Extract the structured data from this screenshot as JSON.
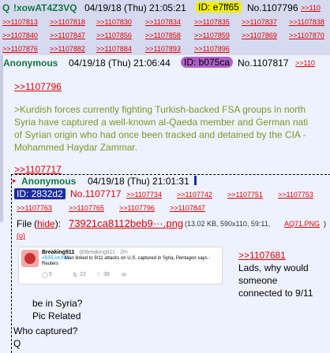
{
  "post1": {
    "name": "Q",
    "tripcode": "!xowAT4Z3VQ",
    "datetime": "04/19/18 (Thu) 21:05:21",
    "id": "ID: e7ff65",
    "number": "No.1107796",
    "trailing_link": ">>110",
    "backlinks_row1": [
      ">>1107813",
      ">>1107818",
      ">>1107830",
      ">>1107834",
      ">>1107835",
      ">>1107837",
      ">>1107838"
    ],
    "backlinks_row2": [
      ">>1107840",
      ">>1107847",
      ">>1107856",
      ">>1107858",
      ">>1107859",
      ">>1107869",
      ">>1107870"
    ],
    "backlinks_row3": [
      ">>1107876",
      ">>1107882",
      ">>1107884",
      ">>1107893",
      ">>1107896"
    ]
  },
  "post2": {
    "name": "Anonymous",
    "datetime": "04/19/18 (Thu) 21:06:44",
    "id": "ID: b075ca",
    "number": "No.1107817",
    "trailing_link": ">>110",
    "reply_link": ">>1107796",
    "greentext": [
      ">Kurdish forces currently fighting Turkish-backed FSA groups in north",
      "Syria have captured a well-known al-Qaeda member and German nati",
      "of Syrian origin who had once been tracked and detained by the CIA -",
      "Mohammed Haydar Zammar."
    ],
    "link2": ">>1107717"
  },
  "quoted": {
    "name": "Anonymous",
    "datetime": "04/19/18 (Thu) 21:01:31",
    "id": "ID: 2832d2",
    "number": "No.1107717",
    "backlinks_row1": [
      ">>1107734",
      ">>1107742",
      ">>1107751",
      ">>1107753"
    ],
    "backlinks_row2": [
      ">>1107763",
      ">>1107765",
      ">>1107796",
      ">>1107847"
    ],
    "file_label": "File",
    "hide": "hide",
    "filename": "73921ca8112beb9···.png",
    "file_meta": "(13.02 KB, 590x110, 59:11,",
    "file_alt": "AQ71.PNG",
    "file_close": ")",
    "u": "(u)",
    "embed": {
      "account": "Breaking911",
      "handle": "@Breaking911 · 2m",
      "text_tag": "#BREAKING:",
      "text": "Man linked to 9/11 attacks on U.S. captured in Syria, Pentagon says -",
      "source": "Reuters",
      "replies": "5",
      "retweets": "22",
      "likes": "38"
    },
    "reply_link": ">>1107681",
    "reply_lines": [
      "Lads, why would",
      "someone",
      "connected to 9/11"
    ],
    "tail_lines": [
      "be in Syria?",
      "Pic Related"
    ],
    "bottom_lines": [
      "Who captured?",
      "Q"
    ]
  },
  "colors": {
    "page_bg": "#eef2ff",
    "post_bg": "#d6daf0",
    "name_green": "#117743",
    "quote_green": "#789922",
    "link_red": "#dd0000",
    "id_yellow": "#f0f000",
    "id_purple": "#b060c8",
    "id_blue": "#1c2da4"
  }
}
